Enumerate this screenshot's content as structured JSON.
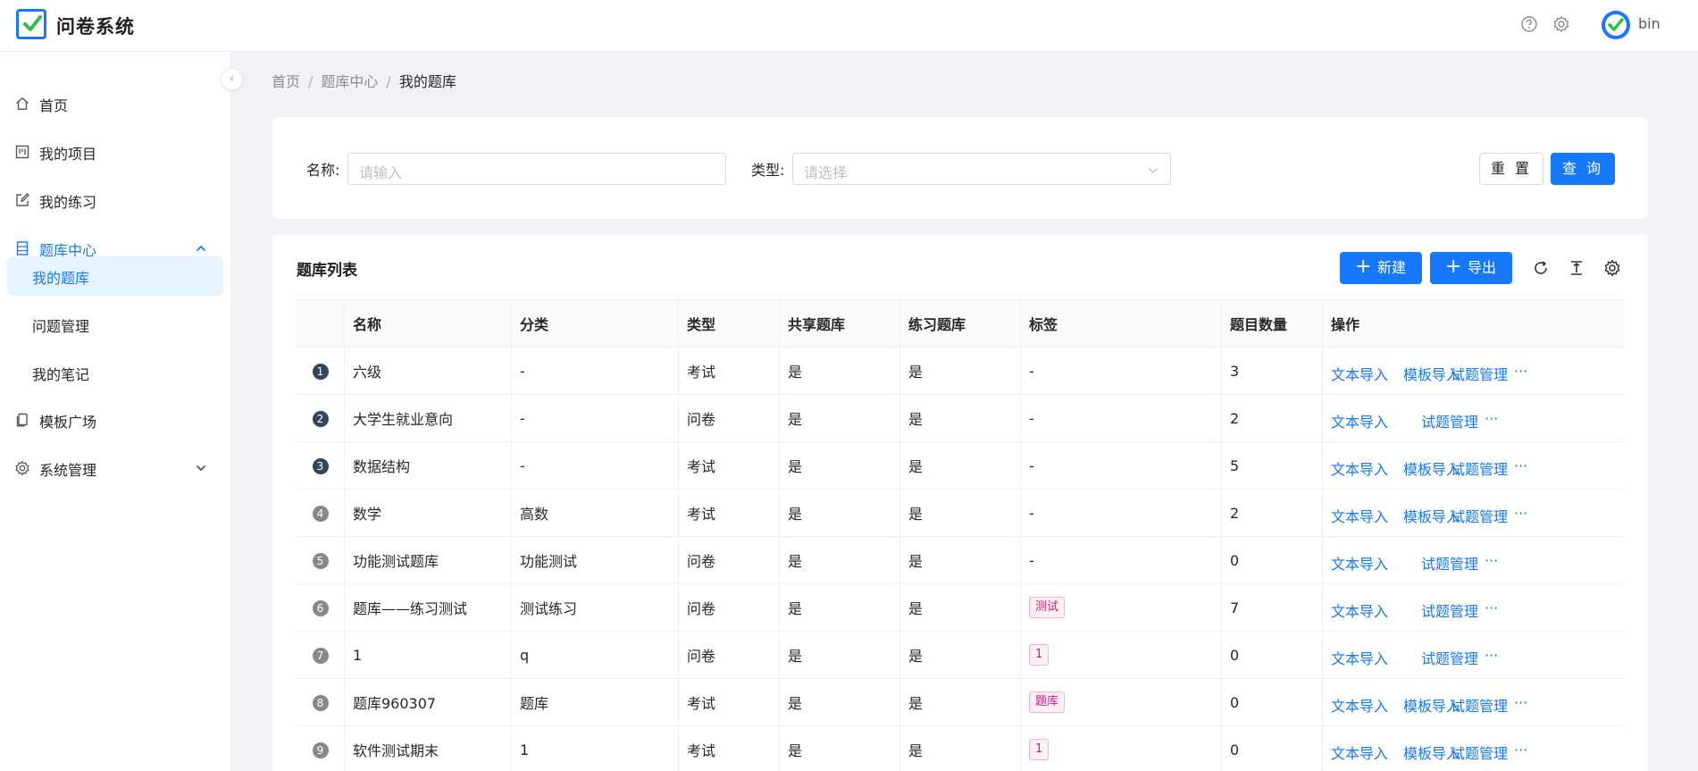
{
  "app": {
    "title": "问卷系统",
    "username": "bin"
  },
  "sidebar": {
    "items": [
      {
        "label": "首页",
        "icon": "home-icon"
      },
      {
        "label": "我的项目",
        "icon": "project-icon"
      },
      {
        "label": "我的练习",
        "icon": "edit-icon"
      },
      {
        "label": "题库中心",
        "icon": "bank-icon",
        "expanded": true,
        "children": [
          {
            "label": "我的题库",
            "active": true
          },
          {
            "label": "问题管理"
          },
          {
            "label": "我的笔记"
          }
        ]
      },
      {
        "label": "模板广场",
        "icon": "template-icon"
      },
      {
        "label": "系统管理",
        "icon": "gear-icon",
        "expanded": false
      }
    ]
  },
  "breadcrumb": {
    "home": "首页",
    "center": "题库中心",
    "current": "我的题库"
  },
  "search": {
    "name_label": "名称:",
    "name_placeholder": "请输入",
    "type_label": "类型:",
    "type_placeholder": "请选择",
    "reset_label": "重 置",
    "query_label": "查 询"
  },
  "table_card": {
    "title": "题库列表",
    "new_label": "新建",
    "export_label": "导出",
    "columns": [
      "名称",
      "分类",
      "类型",
      "共享题库",
      "练习题库",
      "标签",
      "题目数量",
      "操作"
    ],
    "rows": [
      {
        "index": "1",
        "name": "六级",
        "category": "-",
        "type": "考试",
        "shared": "是",
        "practice": "是",
        "tag": "-",
        "tag_is_badge": false,
        "count": "3",
        "actions": [
          "文本导入",
          "模板导入",
          "试题管理",
          "···"
        ]
      },
      {
        "index": "2",
        "name": "大学生就业意向",
        "category": "-",
        "type": "问卷",
        "shared": "是",
        "practice": "是",
        "tag": "-",
        "tag_is_badge": false,
        "count": "2",
        "actions": [
          "文本导入",
          "",
          "试题管理",
          "···"
        ]
      },
      {
        "index": "3",
        "name": "数据结构",
        "category": "-",
        "type": "考试",
        "shared": "是",
        "practice": "是",
        "tag": "-",
        "tag_is_badge": false,
        "count": "5",
        "actions": [
          "文本导入",
          "模板导入",
          "试题管理",
          "···"
        ]
      },
      {
        "index": "4",
        "name": "数学",
        "category": "高数",
        "type": "考试",
        "shared": "是",
        "practice": "是",
        "tag": "-",
        "tag_is_badge": false,
        "count": "2",
        "actions": [
          "文本导入",
          "模板导入",
          "试题管理",
          "···"
        ]
      },
      {
        "index": "5",
        "name": "功能测试题库",
        "category": "功能测试",
        "type": "问卷",
        "shared": "是",
        "practice": "是",
        "tag": "-",
        "tag_is_badge": false,
        "count": "0",
        "actions": [
          "文本导入",
          "",
          "试题管理",
          "···"
        ]
      },
      {
        "index": "6",
        "name": "题库——练习测试",
        "category": "测试练习",
        "type": "问卷",
        "shared": "是",
        "practice": "是",
        "tag": "测试",
        "tag_is_badge": true,
        "count": "7",
        "actions": [
          "文本导入",
          "",
          "试题管理",
          "···"
        ]
      },
      {
        "index": "7",
        "name": "1",
        "category": "q",
        "type": "问卷",
        "shared": "是",
        "practice": "是",
        "tag": "1",
        "tag_is_badge": true,
        "count": "0",
        "actions": [
          "文本导入",
          "",
          "试题管理",
          "···"
        ]
      },
      {
        "index": "8",
        "name": "题库960307",
        "category": "题库",
        "type": "考试",
        "shared": "是",
        "practice": "是",
        "tag": "题库",
        "tag_is_badge": true,
        "count": "0",
        "actions": [
          "文本导入",
          "模板导入",
          "试题管理",
          "···"
        ]
      },
      {
        "index": "9",
        "name": "软件测试期末",
        "category": "1",
        "type": "考试",
        "shared": "是",
        "practice": "是",
        "tag": "1",
        "tag_is_badge": true,
        "count": "0",
        "actions": [
          "文本导入",
          "模板导入",
          "试题管理",
          "···"
        ]
      }
    ]
  },
  "colors": {
    "primary": "#1677ff",
    "tag_text": "#c41d7f",
    "tag_bg": "#fff0f6",
    "index_dark": "#314659",
    "index_gray": "#888888"
  }
}
